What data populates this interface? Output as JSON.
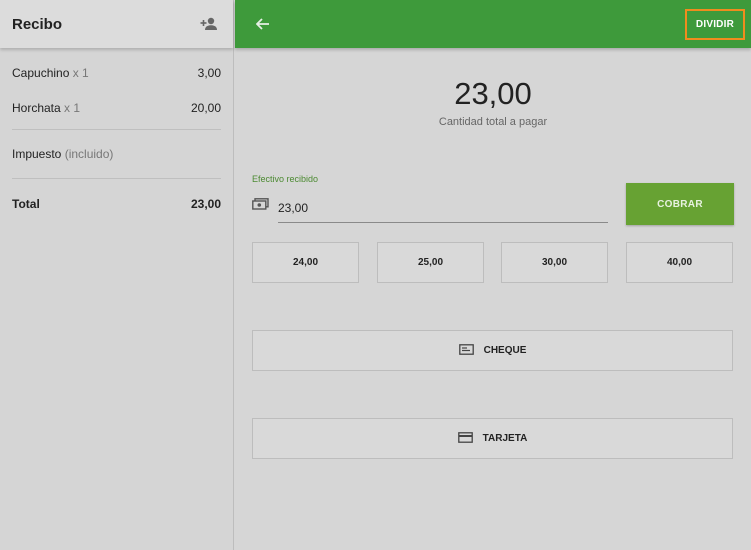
{
  "receipt": {
    "title": "Recibo",
    "items": [
      {
        "name": "Capuchino",
        "qty": "x 1",
        "price": "3,00"
      },
      {
        "name": "Horchata",
        "qty": "x 1",
        "price": "20,00"
      }
    ],
    "tax_label": "Impuesto",
    "tax_note": "(incluido)",
    "total_label": "Total",
    "total_value": "23,00"
  },
  "header": {
    "split_label": "DIVIDIR"
  },
  "payment": {
    "amount": "23,00",
    "amount_label": "Cantidad total a pagar",
    "cash_label": "Efectivo recibido",
    "cash_value": "23,00",
    "charge_label": "COBRAR",
    "quick_amounts": [
      "24,00",
      "25,00",
      "30,00",
      "40,00"
    ],
    "check_label": "CHEQUE",
    "card_label": "TARJETA"
  },
  "colors": {
    "accent": "#3e9a3b",
    "charge": "#67a233",
    "highlight": "#f08c1e"
  },
  "icons": {
    "add_customer": "person-add-icon",
    "back": "arrow-left-icon",
    "cash": "banknote-icon",
    "check": "cheque-icon",
    "card": "credit-card-icon"
  }
}
